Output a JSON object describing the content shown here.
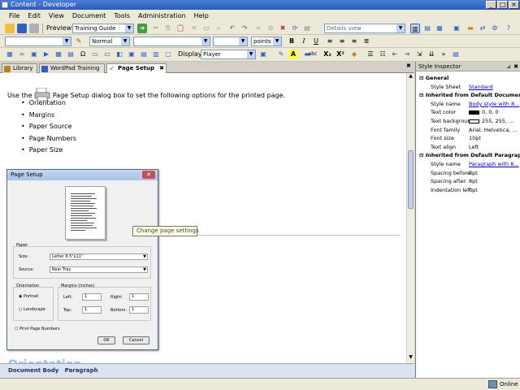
{
  "window": {
    "title": "Content - Developer",
    "controls": [
      "_",
      "□",
      "×"
    ]
  },
  "menu": [
    "File",
    "Edit",
    "View",
    "Document",
    "Tools",
    "Administration",
    "Help"
  ],
  "toolbar1": {
    "preview_label": "Preview:",
    "preview_value": "Training Guide",
    "view_value": "Details view"
  },
  "toolbar2": {
    "style_value": "Normal",
    "size_unit": "points",
    "bold": "B",
    "italic": "I",
    "underline": "U"
  },
  "toolbar3": {
    "display_label": "Display:",
    "display_value": "Player",
    "highlight": "A",
    "abc": "abc",
    "subscript": "X₂",
    "superscript": "X²"
  },
  "tabs": [
    {
      "label": "Library",
      "icon": "library-icon"
    },
    {
      "label": "WordPad Training",
      "icon": "document-icon"
    },
    {
      "label": "Page Setup",
      "icon": "checkmark-icon",
      "active": true
    }
  ],
  "document": {
    "intro_pre": "Use the",
    "intro_post": "Page Setup dialog box to set the following options for the printed page.",
    "bullets": [
      "Orientation",
      "Margins",
      "Paper Source",
      "Page Numbers",
      "Paper Size"
    ],
    "partial_heading": "Orientation"
  },
  "dialog": {
    "title": "Page Setup",
    "paper_label": "Paper",
    "size_label": "Size:",
    "size_value": "Letter 8.5\"x11\"",
    "source_label": "Source:",
    "source_value": "Rear Tray",
    "orientation_label": "Orientation",
    "portrait": "Portrait",
    "landscape": "Landscape",
    "margins_label": "Margins (inches)",
    "left_label": "Left:",
    "left_value": "1",
    "right_label": "Right:",
    "right_value": "1",
    "top_label": "Top:",
    "top_value": "1",
    "bottom_label": "Bottom:",
    "bottom_value": "1",
    "print_page_numbers": "Print Page Numbers",
    "ok": "OK",
    "cancel": "Cancel"
  },
  "tooltip": "Change page settings",
  "footer": {
    "crumb1": "Document Body",
    "crumb2": "Paragraph"
  },
  "inspector": {
    "title": "Style Inspector",
    "sections": [
      {
        "heading": "General",
        "rows": [
          {
            "key": "Style Sheet",
            "value": "Standard",
            "link": true
          }
        ]
      },
      {
        "heading": "Inherited from Default Document",
        "rows": [
          {
            "key": "Style name",
            "value": "Body style with 8...",
            "link": true
          },
          {
            "key": "Text color",
            "value": "0, 0, 0",
            "swatch": "#000000"
          },
          {
            "key": "Text backgrour",
            "value": "255, 255, ...",
            "swatch": "#ffffff"
          },
          {
            "key": "Font family",
            "value": "Arial, Helvetica, ..."
          },
          {
            "key": "Font size",
            "value": "10pt"
          },
          {
            "key": "Text align",
            "value": "Left"
          }
        ]
      },
      {
        "heading": "Inherited from Default Paragraph",
        "rows": [
          {
            "key": "Style name",
            "value": "Paragraph with 8...",
            "link": true
          },
          {
            "key": "Spacing before",
            "value": "8pt"
          },
          {
            "key": "Spacing after",
            "value": "8pt"
          },
          {
            "key": "Indentation left",
            "value": "0pt"
          }
        ]
      }
    ]
  },
  "status": {
    "online": "Online"
  }
}
